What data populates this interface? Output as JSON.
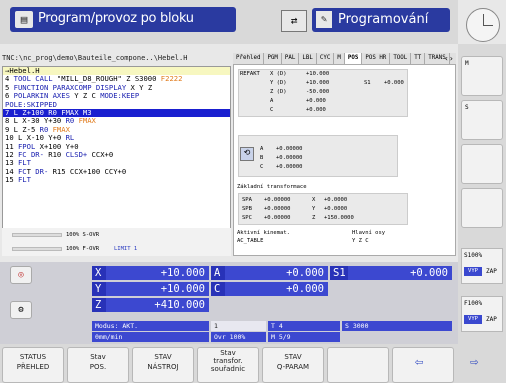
{
  "header": {
    "left_mode": "Program/provoz po bloku",
    "right_mode": "Programování",
    "left_icon": "program-run-icon",
    "right_icon": "edit-icon"
  },
  "program": {
    "path": "TNC:\\nc_prog\\demo\\Bauteile_compone..\\Hebel.H",
    "lines": [
      {
        "n": "→Hebel.H",
        "cls": "hl"
      },
      {
        "n": "4  TOOL CALL \"MILL_D8_ROUGH\" Z S3000 F2222"
      },
      {
        "n": "5  FUNCTION PARAXCOMP DISPLAY X Y Z"
      },
      {
        "n": "6  POLARKIN AXES Y Z C MODE:KEEP"
      },
      {
        "n": "   POLE:SKIPPED"
      },
      {
        "n": "7  L  Z+100 R0 FMAX M3",
        "cls": "sel"
      },
      {
        "n": "8  L  X-30  Y+30 R0 FMAX"
      },
      {
        "n": "9  L  Z-5 R0 FMAX"
      },
      {
        "n": "10 L  X-10  Y+0 RL"
      },
      {
        "n": "11 FPOL  X+100  Y+0"
      },
      {
        "n": "12 FC DR- R10 CLSD+  CCX+0"
      },
      {
        "n": "13 FLT"
      },
      {
        "n": "14 FCT DR- R15  CCX+100  CCY+0"
      },
      {
        "n": "15 FLT"
      }
    ]
  },
  "override": {
    "s_ovr": "100% S-OVR",
    "f_ovr": "100% F-OVR",
    "limit": "LIMIT 1"
  },
  "tabs": [
    "Přehled",
    "PGM",
    "PAL",
    "LBL",
    "CYC",
    "M",
    "POS",
    "POS HR",
    "TOOL",
    "TT",
    "TRANS"
  ],
  "active_tab": "POS",
  "refakt": {
    "label": "REFAKT",
    "rows": [
      [
        "X (D)",
        "+10.000",
        "",
        ""
      ],
      [
        "Y (D)",
        "+10.000",
        "S1",
        "+0.000"
      ],
      [
        "Z (D)",
        "-50.000",
        "",
        ""
      ],
      [
        "A",
        "+0.000",
        "",
        ""
      ],
      [
        "C",
        "+0.000",
        "",
        ""
      ]
    ]
  },
  "rot": {
    "rows": [
      [
        "A",
        "+0.00000"
      ],
      [
        "B",
        "+0.00000"
      ],
      [
        "C",
        "+0.00000"
      ]
    ]
  },
  "basic": {
    "title": "Základní transformace",
    "rows": [
      [
        "SPA",
        "+0.00000",
        "X",
        "+0.0000"
      ],
      [
        "SPB",
        "+0.00000",
        "Y",
        "+0.0000"
      ],
      [
        "SPC",
        "+0.00000",
        "Z",
        "+150.0000"
      ]
    ]
  },
  "kin": {
    "label": "Aktivní kinemat.",
    "value": "AC_TABLE",
    "axes_label": "Hlavní osy",
    "axes": "Y Z C"
  },
  "positions": {
    "X": "+10.000",
    "Y": "+10.000",
    "Z": "+410.000",
    "A": "+0.000",
    "C": "+0.000",
    "S1": "+0.000"
  },
  "status": {
    "modus": "Modus: AKT.",
    "tool_num": "T 4",
    "spindle": "S 3000",
    "feed": "0mm/min",
    "ovr": "Ovr 100%",
    "m": "M 5/9",
    "tool_icon": "1"
  },
  "softkeys": [
    [
      "STATUS",
      "PŘEHLED"
    ],
    [
      "Stav",
      "POS."
    ],
    [
      "STAV",
      "NÁSTROJ"
    ],
    [
      "Stav",
      "transfor.",
      "souřadnic"
    ],
    [
      "STAV",
      "Q-PARAM"
    ],
    [
      "",
      ""
    ],
    [
      "",
      ""
    ]
  ],
  "side": {
    "s_ovr": "S100%",
    "f_ovr": "F100%",
    "vyp": "VYP",
    "zap": "ZAP",
    "m_label": "M",
    "s_label": "S"
  }
}
